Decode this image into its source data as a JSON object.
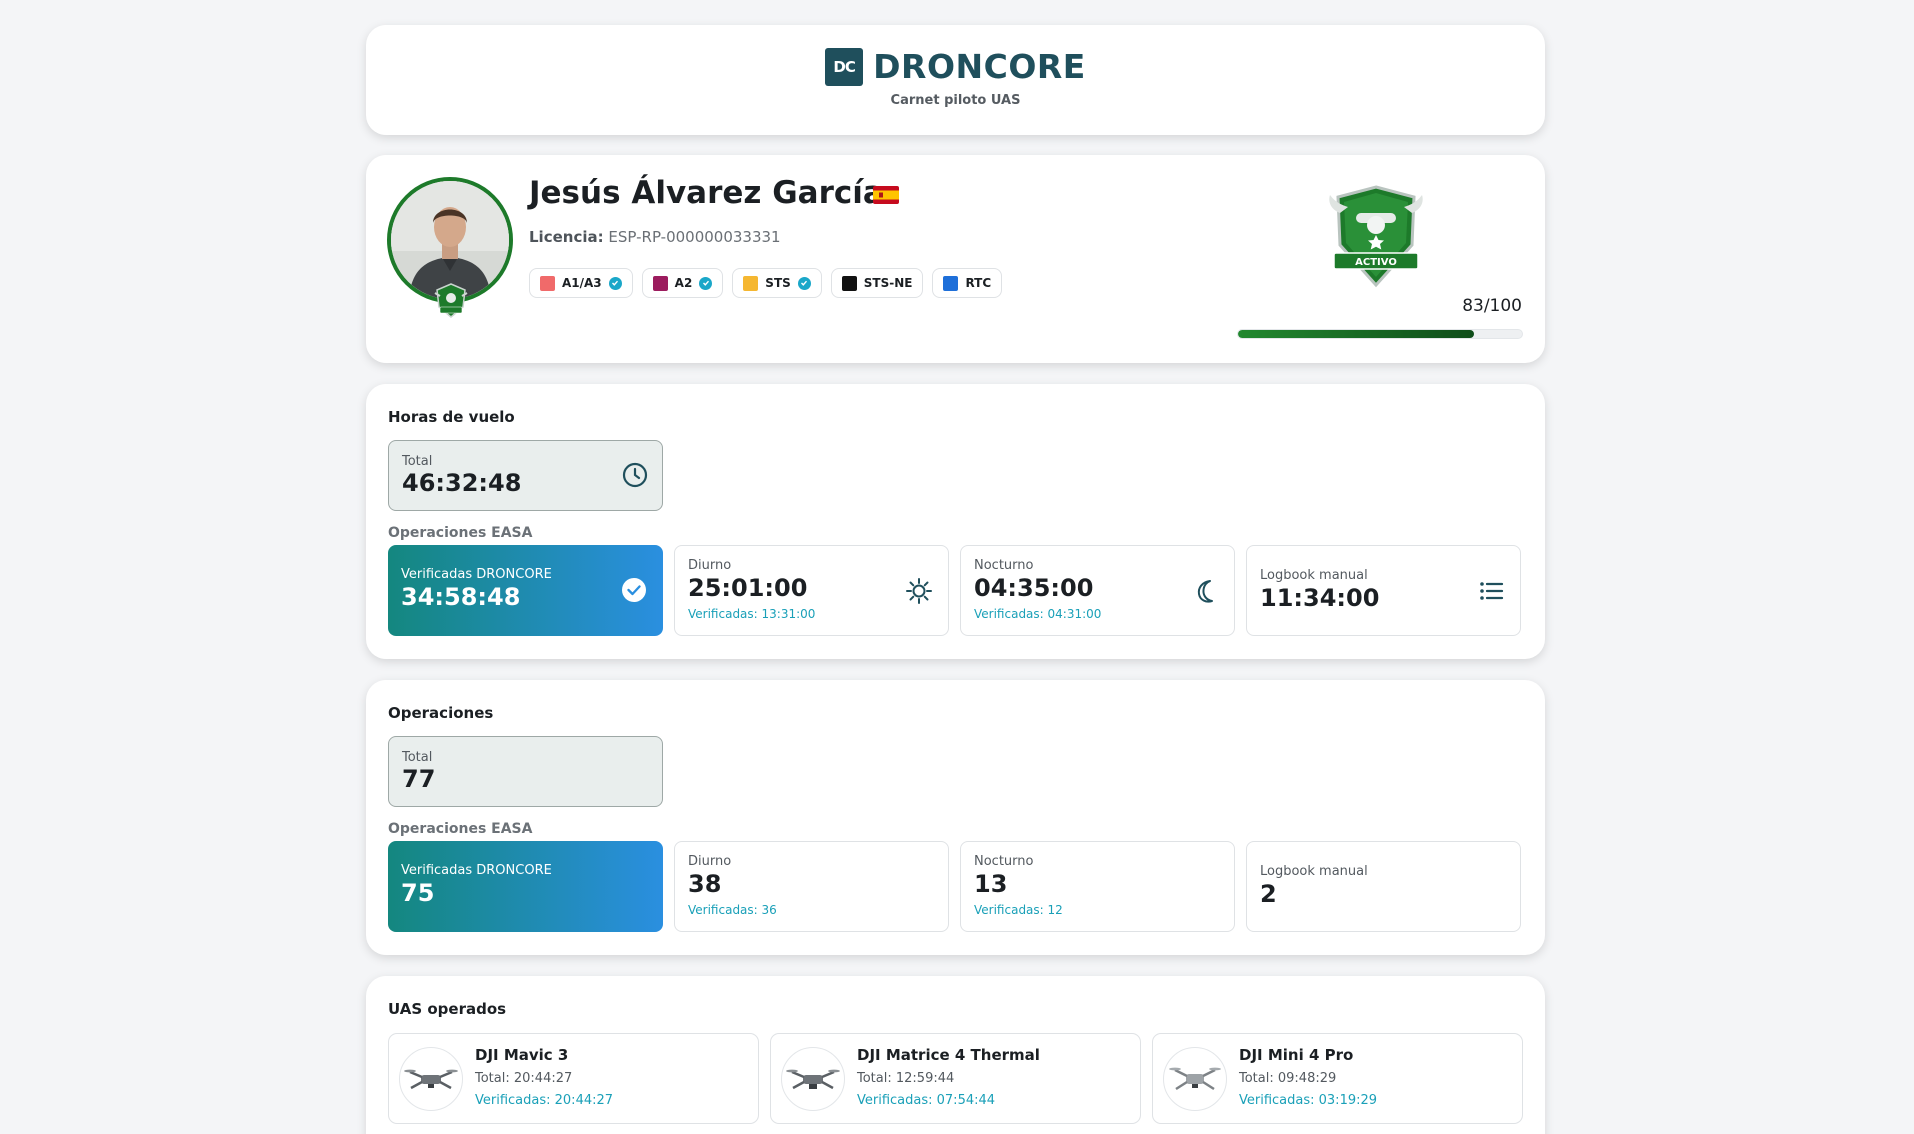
{
  "brand": {
    "logo_text": "DC",
    "name": "DRONCORE",
    "subtitle": "Carnet piloto UAS",
    "color": "#1f4f5c"
  },
  "pilot": {
    "name": "Jesús Álvarez García",
    "flag": "spain-flag",
    "license_label": "Licencia:",
    "license_number": "ESP-RP-000000033331",
    "avatar_badge_text": "ACTIVO",
    "certifications": [
      {
        "label": "A1/A3",
        "color": "#f06a6a",
        "verified": true
      },
      {
        "label": "A2",
        "color": "#9c1c5e",
        "verified": true
      },
      {
        "label": "STS",
        "color": "#f5b731",
        "verified": true
      },
      {
        "label": "STS-NE",
        "color": "#111111",
        "verified": false
      },
      {
        "label": "RTC",
        "color": "#1e6fd9",
        "verified": false
      }
    ],
    "status_badge": "ACTIVO",
    "score_text": "83/100",
    "score_fraction": 0.83,
    "accent_color": "#1d7a2a"
  },
  "flight_hours": {
    "title": "Horas de vuelo",
    "total_label": "Total",
    "total_value": "46:32:48",
    "easa_label": "Operaciones EASA",
    "tiles": [
      {
        "label": "Verificadas DRONCORE",
        "value": "34:58:48",
        "sub": "",
        "icon": "check-circle-icon"
      },
      {
        "label": "Diurno",
        "value": "25:01:00",
        "sub": "Verificadas: 13:31:00",
        "icon": "sun-icon"
      },
      {
        "label": "Nocturno",
        "value": "04:35:00",
        "sub": "Verificadas: 04:31:00",
        "icon": "moon-icon"
      },
      {
        "label": "Logbook manual",
        "value": "11:34:00",
        "sub": "",
        "icon": "list-icon"
      }
    ]
  },
  "operations": {
    "title": "Operaciones",
    "total_label": "Total",
    "total_value": "77",
    "easa_label": "Operaciones EASA",
    "tiles": [
      {
        "label": "Verificadas DRONCORE",
        "value": "75",
        "sub": ""
      },
      {
        "label": "Diurno",
        "value": "38",
        "sub": "Verificadas: 36"
      },
      {
        "label": "Nocturno",
        "value": "13",
        "sub": "Verificadas: 12"
      },
      {
        "label": "Logbook manual",
        "value": "2",
        "sub": ""
      }
    ]
  },
  "uas": {
    "title": "UAS operados",
    "items": [
      {
        "name": "DJI Mavic 3",
        "total": "Total: 20:44:27",
        "verified": "Verificadas: 20:44:27"
      },
      {
        "name": "DJI Matrice 4 Thermal",
        "total": "Total: 12:59:44",
        "verified": "Verificadas: 07:54:44"
      },
      {
        "name": "DJI Mini 4 Pro",
        "total": "Total: 09:48:29",
        "verified": "Verificadas: 03:19:29"
      }
    ]
  }
}
